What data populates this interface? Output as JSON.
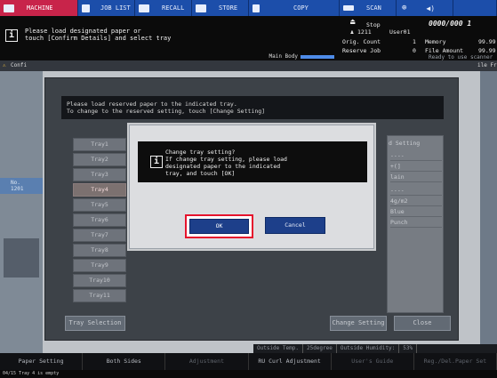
{
  "tabs": [
    {
      "label": "MACHINE",
      "icon": "printer-icon"
    },
    {
      "label": "JOB LIST",
      "icon": "list-icon"
    },
    {
      "label": "RECALL",
      "icon": "recall-icon"
    },
    {
      "label": "STORE",
      "icon": "store-icon"
    },
    {
      "label": "COPY",
      "icon": "copy-icon"
    },
    {
      "label": "SCAN",
      "icon": "scan-icon"
    },
    {
      "label": "",
      "icon": "globe-icon"
    },
    {
      "label": "",
      "icon": "speaker-icon"
    }
  ],
  "message": {
    "line1": "Please load designated paper or",
    "line2": "touch [Confirm Details] and select tray"
  },
  "main_body": "Main Body",
  "status": {
    "stop": "Stop",
    "counter": "0000/000 1",
    "group": "1211",
    "user": "User01",
    "orig_count_label": "Orig. Count",
    "orig_count": "1",
    "memory_label": "Memory",
    "memory": "99.99",
    "reserve_label": "Reserve Job",
    "reserve": "0",
    "file_label": "File Amount",
    "file": "99.99",
    "ready": "Ready to use scanner"
  },
  "subheader": {
    "left": "Confi",
    "right": "ile Fr"
  },
  "left_panel": {
    "no_label": "No.",
    "no_value": "1201"
  },
  "dialog": {
    "line1": "Please load reserved paper to the indicated tray.",
    "line2": "To change to the reserved setting, touch [Change Setting]",
    "trays": [
      "Tray1",
      "Tray2",
      "Tray3",
      "Tray4",
      "Tray5",
      "Tray6",
      "Tray7",
      "Tray8",
      "Tray9",
      "Tray10",
      "Tray11"
    ],
    "selected_tray": "Tray4",
    "setting_head": "d Setting",
    "setting_rows": [
      "----",
      "+(]",
      "lain",
      "----",
      "4g/m2",
      "Blue",
      "Punch"
    ],
    "tray_selection": "Tray Selection",
    "change_setting": "Change Setting",
    "close": "Close"
  },
  "modal": {
    "line1": "Change tray setting?",
    "line2": "If change tray setting, please load",
    "line3": "designated paper to the indicated",
    "line4": "tray, and touch [OK]",
    "ok": "OK",
    "cancel": "Cancel"
  },
  "env": {
    "outside_temp_label": "Outside Temp.",
    "outside_temp": "25degree",
    "humidity_label": "Outside Humidity:",
    "humidity": "53%"
  },
  "function_keys": [
    "Paper Setting",
    "Both Sides",
    "Adjustment",
    "RU Curl Adjustment",
    "User's Guide",
    "Reg./Del.Paper Set"
  ],
  "footer": "04/15 Tray 4 is empty"
}
